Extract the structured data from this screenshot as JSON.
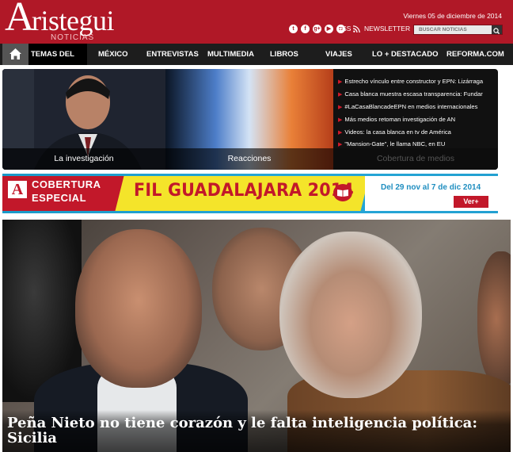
{
  "header": {
    "logo_main": "Aristegui",
    "logo_initial": "A",
    "logo_rest": "ristegui",
    "logo_sub": "NOTICIAS",
    "date": "Viernes 05 de diciembre de 2014",
    "social_icons": [
      {
        "name": "twitter-icon",
        "glyph": "t"
      },
      {
        "name": "facebook-icon",
        "glyph": "f"
      },
      {
        "name": "google-plus-icon",
        "glyph": "g+"
      },
      {
        "name": "youtube-icon",
        "glyph": "▶"
      },
      {
        "name": "instagram-icon",
        "glyph": "◘"
      }
    ],
    "rss_label": "RSS",
    "newsletter_label": "NEWSLETTER",
    "search_placeholder": "BUSCAR NOTICIAS",
    "brand_color": "#b01827"
  },
  "nav": {
    "home_icon": "home-icon",
    "items": [
      {
        "label": "TEMAS DEL DÍA"
      },
      {
        "label": "MÉXICO"
      },
      {
        "label": "ENTREVISTAS"
      },
      {
        "label": "MULTIMEDIA"
      },
      {
        "label": "LIBROS"
      },
      {
        "label": "VIAJES"
      },
      {
        "label": "LO + DESTACADO"
      },
      {
        "label": "REFORMA.COM"
      }
    ]
  },
  "featured": {
    "captions": [
      "La investigación",
      "Reacciones",
      "Cobertura de medios"
    ],
    "headlines": [
      "Estrecho vínculo entre constructor y EPN: Lizárraga",
      "Casa blanca muestra escasa transparencia: Fundar",
      "#LaCasaBlancadeEPN en medios internacionales",
      "Más medios retoman investigación de AN",
      "Videos: la casa blanca en tv de América",
      "\"Mansion-Gate\", le llama NBC, en EU"
    ]
  },
  "banner": {
    "logo_letter": "A",
    "line1": "COBERTURA",
    "line2": "ESPECIAL",
    "title": "FIL GUADALAJARA 2014",
    "dates": "Del 29 nov al 7 de dic 2014",
    "cta": "Ver+"
  },
  "hero": {
    "title": "Peña Nieto no tiene corazón y le falta inteligencia política: Sicilia"
  }
}
